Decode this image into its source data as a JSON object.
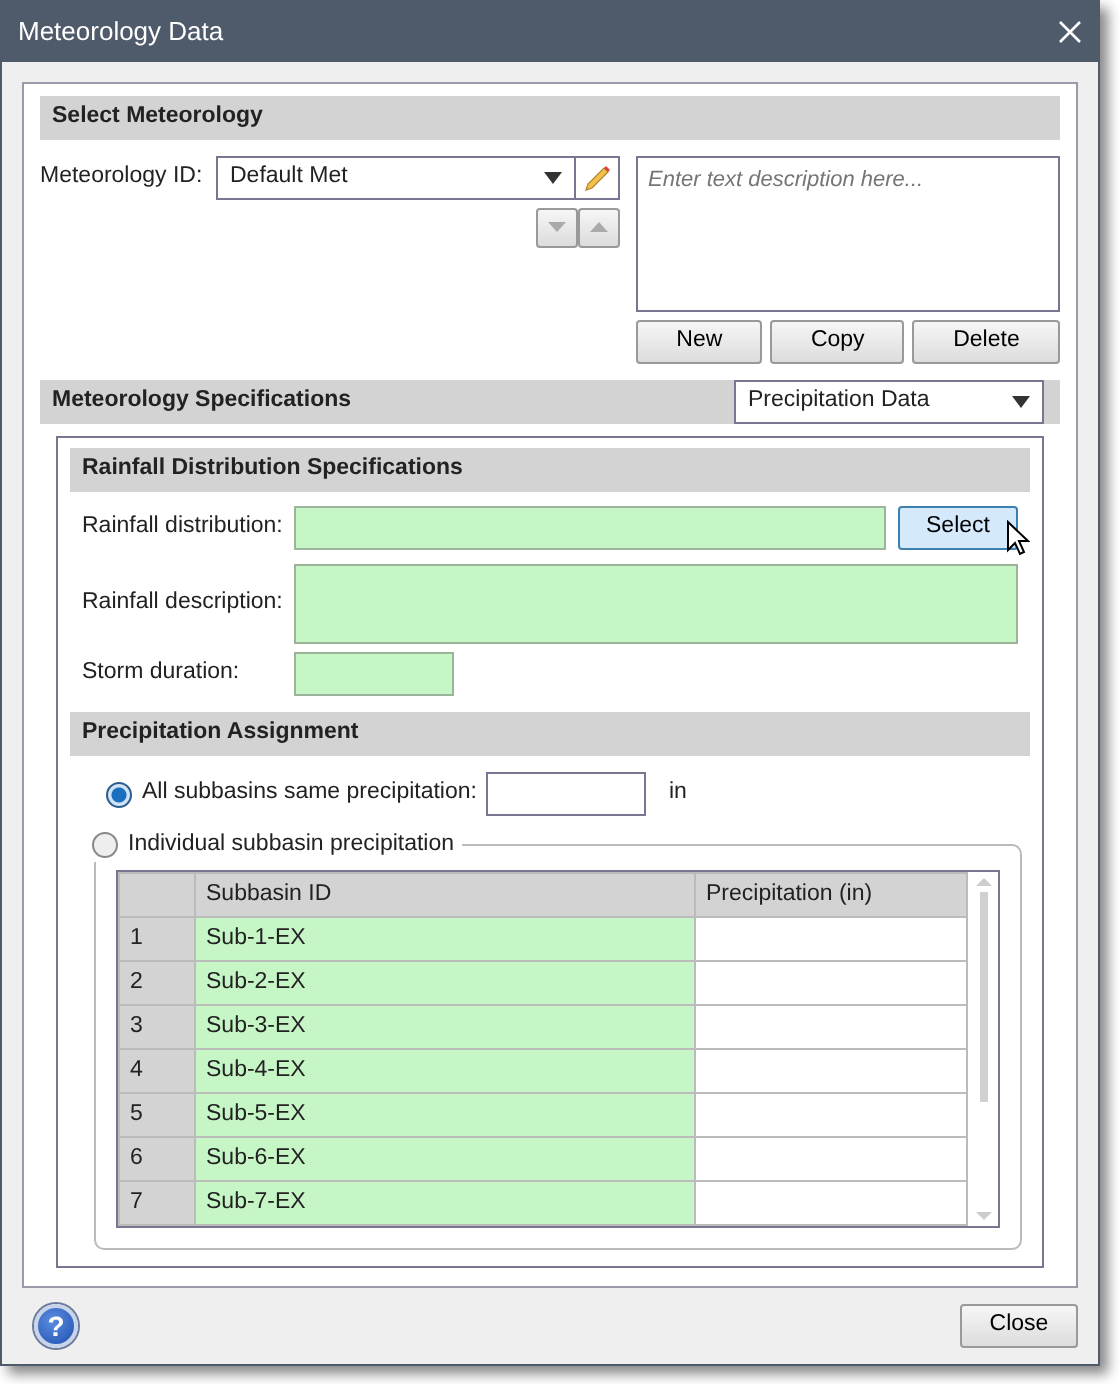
{
  "window": {
    "title": "Meteorology Data"
  },
  "select_meteorology": {
    "heading": "Select Meteorology",
    "id_label": "Meteorology ID:",
    "id_value": "Default Met",
    "description_placeholder": "Enter text description here...",
    "buttons": [
      "New",
      "Copy",
      "Delete"
    ]
  },
  "specifications": {
    "heading": "Meteorology Specifications",
    "type_value": "Precipitation Data"
  },
  "rainfall": {
    "heading": "Rainfall Distribution Specifications",
    "distribution_label": "Rainfall distribution:",
    "select_button": "Select",
    "description_label": "Rainfall description:",
    "duration_label": "Storm duration:"
  },
  "assignment": {
    "heading": "Precipitation Assignment",
    "options": [
      {
        "label": "All subbasins same precipitation:",
        "selected": true,
        "unit": "in"
      },
      {
        "label": "Individual subbasin precipitation",
        "selected": false
      }
    ],
    "table": {
      "columns": [
        "Subbasin ID",
        "Precipitation (in)"
      ],
      "rows": [
        {
          "index": "1",
          "subbasin": "Sub-1-EX"
        },
        {
          "index": "2",
          "subbasin": "Sub-2-EX"
        },
        {
          "index": "3",
          "subbasin": "Sub-3-EX"
        },
        {
          "index": "4",
          "subbasin": "Sub-4-EX"
        },
        {
          "index": "5",
          "subbasin": "Sub-5-EX"
        },
        {
          "index": "6",
          "subbasin": "Sub-6-EX"
        },
        {
          "index": "7",
          "subbasin": "Sub-7-EX"
        }
      ]
    }
  },
  "footer": {
    "help": "?",
    "close": "Close"
  }
}
